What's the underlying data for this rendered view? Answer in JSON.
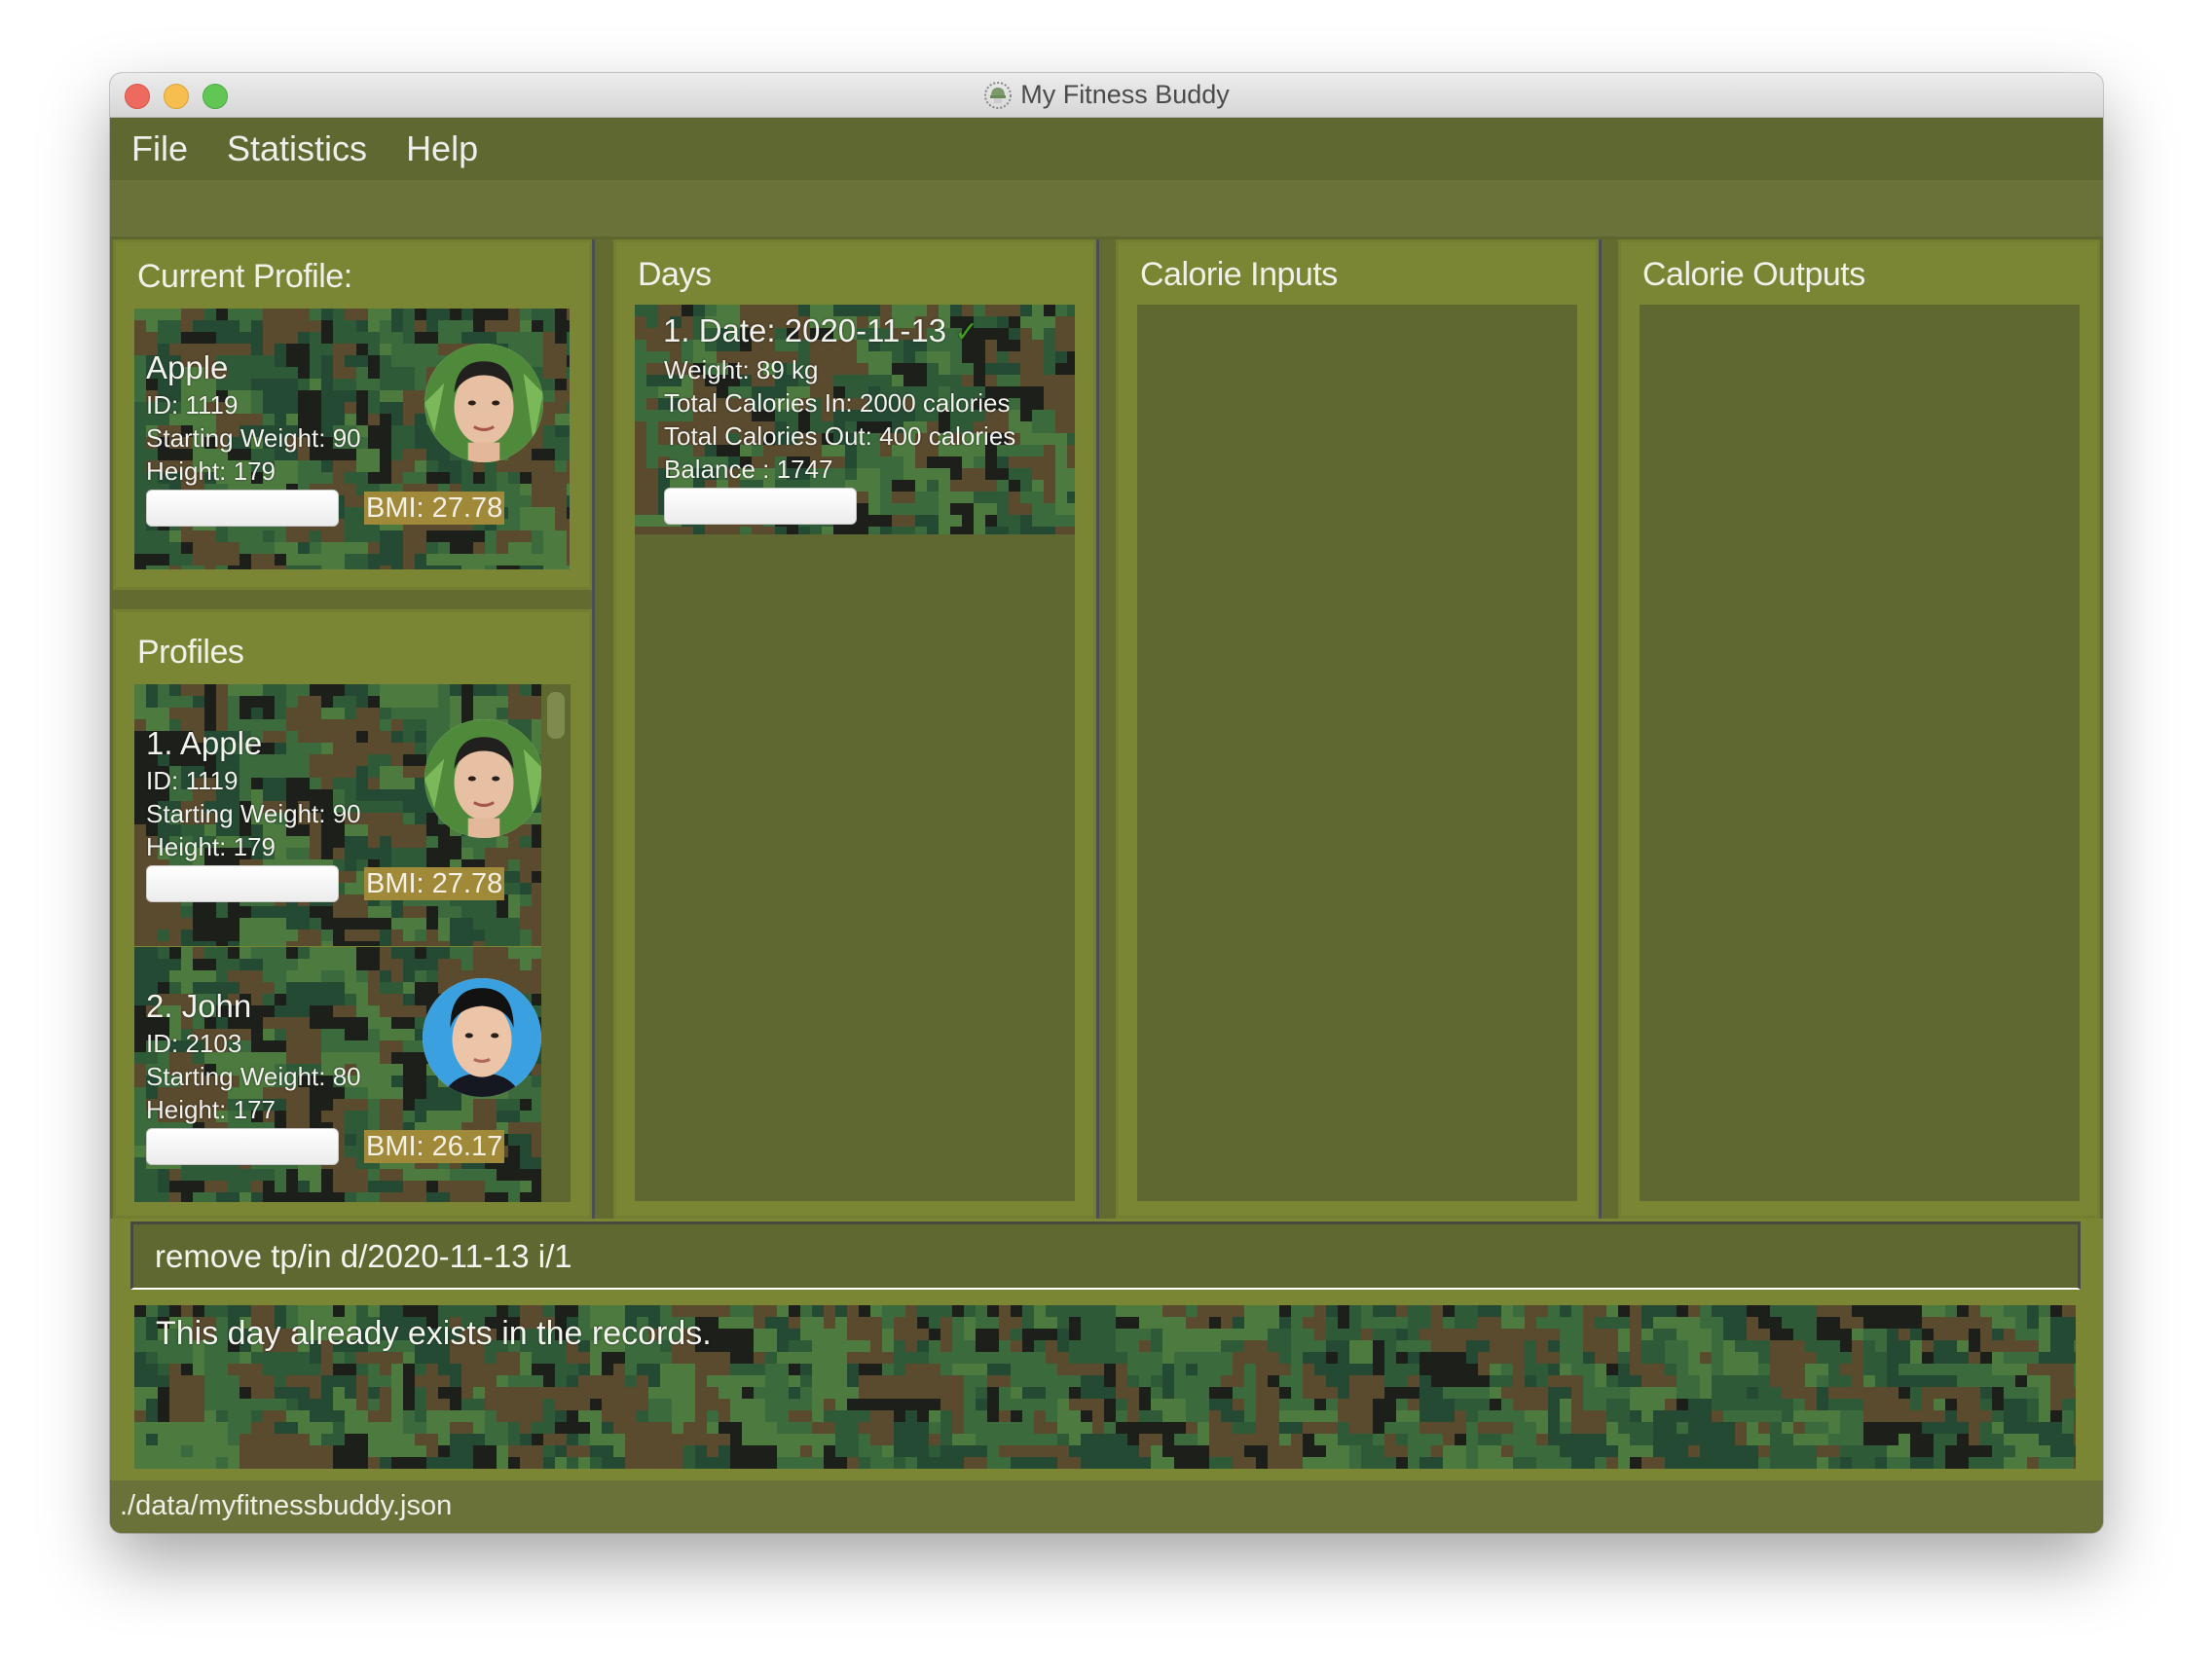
{
  "window": {
    "title": "My Fitness Buddy",
    "app_icon": "helmet-logo-icon"
  },
  "menu": {
    "items": [
      {
        "label": "File"
      },
      {
        "label": "Statistics"
      },
      {
        "label": "Help"
      }
    ]
  },
  "current_profile": {
    "heading": "Current Profile:",
    "name": "Apple",
    "id_line": "ID: 1119",
    "weight_line": "Starting Weight: 90",
    "height_line": "Height: 179",
    "bmi": "BMI: 27.78",
    "progress": 0
  },
  "profiles": {
    "heading": "Profiles",
    "items": [
      {
        "index_name": "1.  Apple",
        "id_line": "ID: 1119",
        "weight_line": "Starting Weight: 90",
        "height_line": "Height: 179",
        "bmi": "BMI: 27.78",
        "progress": 0
      },
      {
        "index_name": "2.  John",
        "id_line": "ID: 2103",
        "weight_line": "Starting Weight: 80",
        "height_line": "Height: 177",
        "bmi": "BMI: 26.17",
        "progress": 0
      }
    ]
  },
  "days": {
    "heading": "Days",
    "items": [
      {
        "title": "1.  Date: 2020-11-13",
        "check": "✓",
        "weight_line": "Weight: 89 kg",
        "cal_in_line": "Total Calories In: 2000 calories",
        "cal_out_line": "Total Calories Out: 400 calories",
        "balance_line": "Balance : 1747",
        "progress": 0
      }
    ]
  },
  "calorie_inputs": {
    "heading": "Calorie Inputs"
  },
  "calorie_outputs": {
    "heading": "Calorie Outputs"
  },
  "command": {
    "value": "remove tp/in d/2020-11-13 i/1"
  },
  "result": {
    "message": "This day already exists in the records."
  },
  "status": {
    "path": "./data/myfitnessbuddy.json"
  },
  "colors": {
    "menu_bg": "#5f6830",
    "panel_bg": "#7b8634",
    "list_bg": "#5f6830",
    "bmi_bg": "#a08a39",
    "check": "#3f9a1e"
  }
}
